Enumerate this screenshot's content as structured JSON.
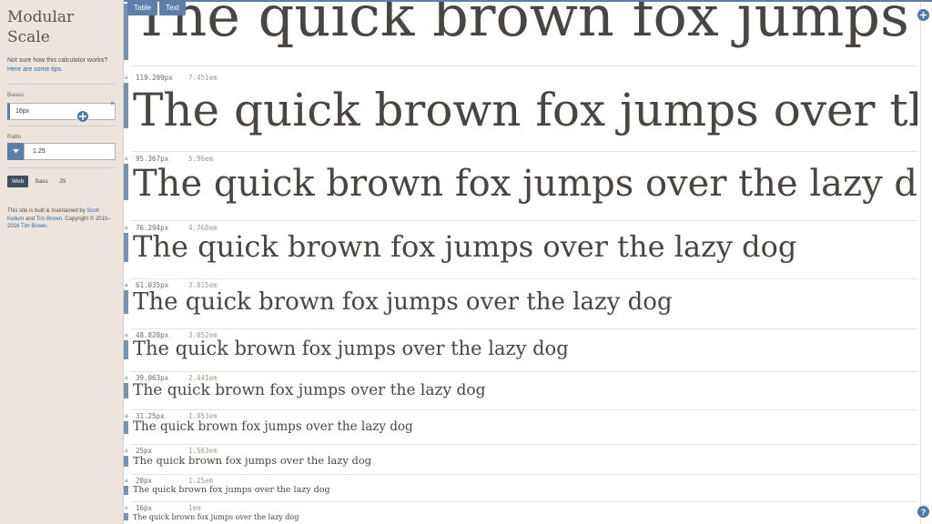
{
  "sidebar": {
    "title": "Modular Scale",
    "help_prefix": "Not sure how this calculator works? ",
    "help_link": "Here are some tips.",
    "bases_label": "Bases",
    "bases_value": "16px",
    "bases_unit": "a",
    "ratio_label": "Ratio",
    "ratio_value": "1.25",
    "format_tabs": [
      "Web",
      "Sass",
      "JS"
    ],
    "credits_prefix": "This site is built & maintained by ",
    "credits_author1": "Scott Kellum",
    "credits_and": " and ",
    "credits_author2": "Tim Brown",
    "credits_suffix": ". Copyright © 2010–2016 ",
    "credits_author3": "Tim Brown",
    "credits_end": "."
  },
  "view_tabs": [
    "Table",
    "Text"
  ],
  "sample_text": "The quick brown fox jumps over the lazy dog",
  "scale_rows": [
    {
      "px": "",
      "em": ""
    },
    {
      "px": "119.209px",
      "em": "7.451em"
    },
    {
      "px": "95.367px",
      "em": "5.96em"
    },
    {
      "px": "76.294px",
      "em": "4.768em"
    },
    {
      "px": "61.035px",
      "em": "3.815em"
    },
    {
      "px": "48.828px",
      "em": "3.052em"
    },
    {
      "px": "39.063px",
      "em": "2.441em"
    },
    {
      "px": "31.25px",
      "em": "1.953em"
    },
    {
      "px": "25px",
      "em": "1.563em"
    },
    {
      "px": "20px",
      "em": "1.25em"
    },
    {
      "px": "16px",
      "em": "1em"
    }
  ],
  "row_marker": "a",
  "icons": {
    "add": "plus-icon",
    "help": "question-icon",
    "ratio_toggle": "chevron-down-icon"
  },
  "help_glyph": "?",
  "colors": {
    "accent": "#5b7fa8",
    "sidebar_bg": "#ece4dd",
    "text": "#4a4540"
  }
}
